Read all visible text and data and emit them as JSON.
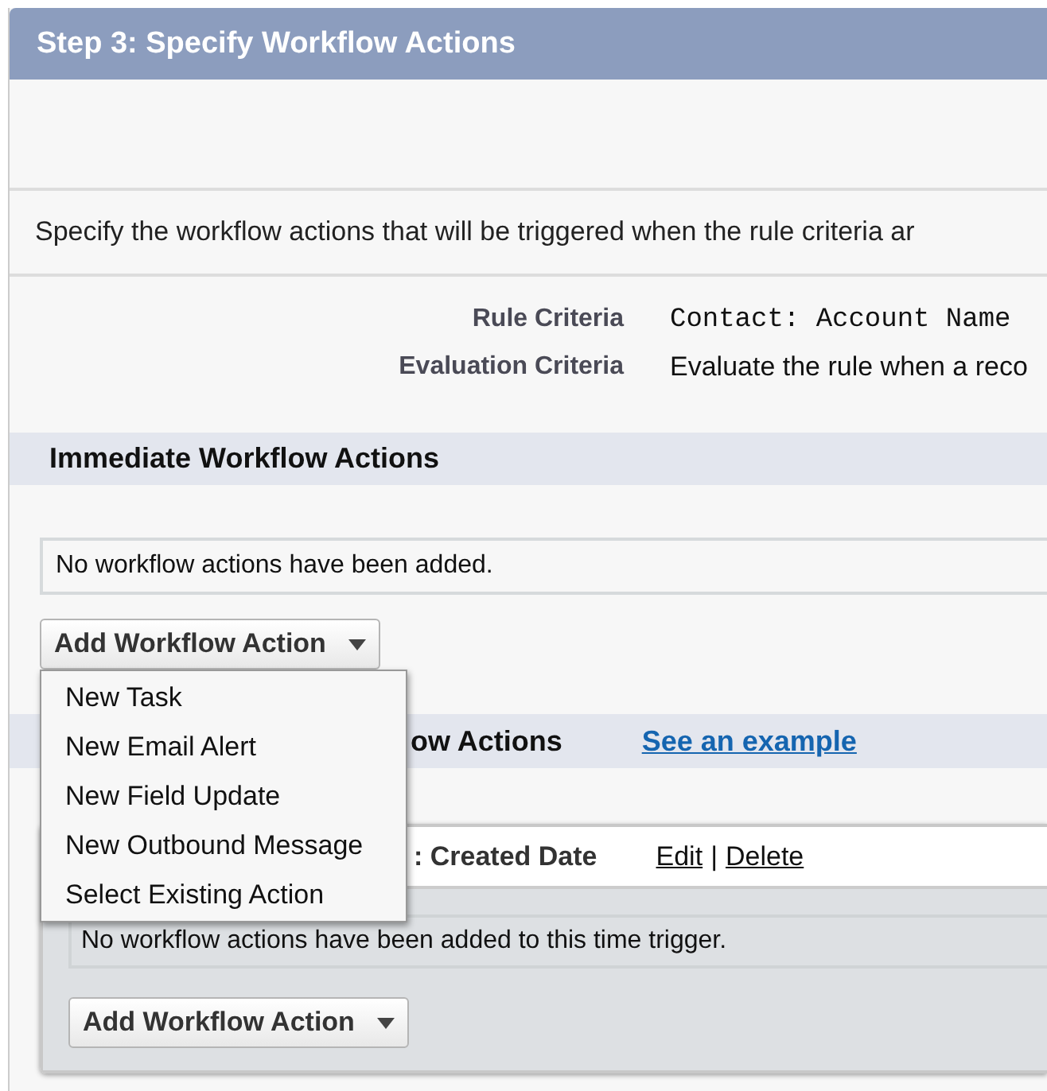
{
  "header": {
    "title": "Step 3: Specify Workflow Actions"
  },
  "description": "Specify the workflow actions that will be triggered when the rule criteria ar",
  "criteria": [
    {
      "label": "Rule Criteria",
      "value": "Contact: Account Name",
      "kind": "code"
    },
    {
      "label": "Evaluation Criteria",
      "value": "Evaluate the rule when a reco",
      "kind": "text"
    }
  ],
  "immediate": {
    "title": "Immediate Workflow Actions",
    "empty_message": "No workflow actions have been added.",
    "add_button": "Add Workflow Action"
  },
  "dropdown_menu": {
    "items": [
      "New Task",
      "New Email Alert",
      "New Field Update",
      "New Outbound Message",
      "Select Existing Action"
    ]
  },
  "time_dependent": {
    "title": "ow Actions",
    "link": "See an example",
    "trigger": {
      "label": ": Created Date",
      "edit": "Edit",
      "separator": "|",
      "delete": "Delete",
      "empty_message": "No workflow actions have been added to this time trigger.",
      "add_button": "Add Workflow Action"
    }
  }
}
